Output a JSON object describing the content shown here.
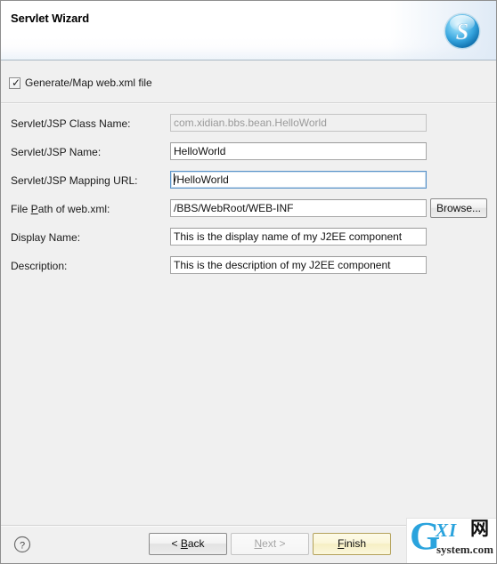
{
  "header": {
    "title": "Servlet Wizard",
    "logo_icon": "blue-sphere-s-icon",
    "logo_letter": "S"
  },
  "options": {
    "generate_web_xml": {
      "label": "Generate/Map web.xml file",
      "checked": true,
      "check_glyph": "✓"
    }
  },
  "form": {
    "rows": [
      {
        "label": "Servlet/JSP Class Name:",
        "label_prefix": "Servlet/JSP Class Name:",
        "value": "com.xidian.bbs.bean.HelloWorld",
        "state": "disabled"
      },
      {
        "label": "Servlet/JSP Name:",
        "value": "HelloWorld",
        "state": "normal"
      },
      {
        "label": "Servlet/JSP Mapping URL:",
        "value": "/HelloWorld",
        "state": "focused"
      },
      {
        "label_before": "File ",
        "label_mnemonic": "P",
        "label_after": "ath of web.xml:",
        "label": "File Path of web.xml:",
        "value": "/BBS/WebRoot/WEB-INF",
        "state": "normal",
        "browse_label": "Browse..."
      },
      {
        "label": "Display Name:",
        "value": "This is the display name of my J2EE component",
        "state": "normal"
      },
      {
        "label": "Description:",
        "value": "This is the description of my J2EE component",
        "state": "normal"
      }
    ]
  },
  "footer": {
    "help_icon": "question-mark-help-icon",
    "help_glyph": "?",
    "buttons": [
      {
        "label_before": "< ",
        "mnemonic": "B",
        "label_after": "ack",
        "label": "< Back",
        "state": "enabled"
      },
      {
        "label_before": "",
        "mnemonic": "N",
        "label_after": "ext >",
        "label": "Next >",
        "state": "disabled"
      },
      {
        "label_before": "",
        "mnemonic": "F",
        "label_after": "inish",
        "label": "Finish",
        "state": "default"
      }
    ]
  },
  "watermark": {
    "g": "G",
    "xi": "XI",
    "cjk": "网",
    "sub": "system.com",
    "accent_color": "#2aa3dd"
  },
  "colors": {
    "dialog_bg": "#f0f0f0",
    "banner_bg": "#ffffff",
    "banner_accent": "#dfeaf6",
    "focus_border": "#5a93c9",
    "default_button_border": "#b3a15b",
    "logo_blue": "#3aa5de"
  }
}
